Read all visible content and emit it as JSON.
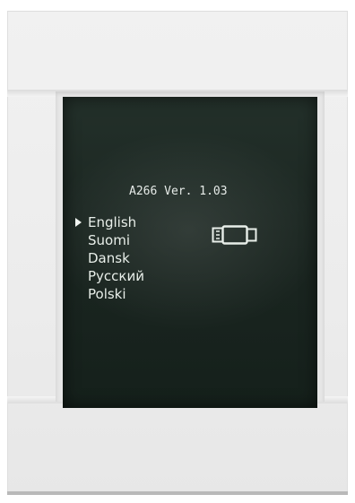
{
  "device": {
    "version": "A266 Ver. 1.03"
  },
  "menu": {
    "items": [
      {
        "label": "English",
        "selected": true
      },
      {
        "label": "Suomi",
        "selected": false
      },
      {
        "label": "Dansk",
        "selected": false
      },
      {
        "label": "Русский",
        "selected": false
      },
      {
        "label": "Polski",
        "selected": false
      }
    ],
    "pointer_icon": "triangle-right-icon",
    "status_icon": "usb-connector-icon"
  },
  "colors": {
    "screen": "#1b2621",
    "text": "#e8eee9",
    "panel": "#ececec"
  }
}
